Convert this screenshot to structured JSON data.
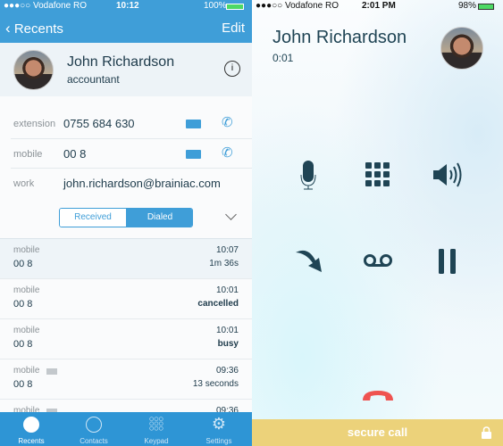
{
  "left": {
    "status": {
      "carrier": "●●●○○ Vodafone RO",
      "time": "10:12",
      "battery": "100%"
    },
    "nav": {
      "back_label": "Recents",
      "edit_label": "Edit"
    },
    "contact": {
      "first": "John",
      "last": "Richardson",
      "title": "accountant"
    },
    "fields": [
      {
        "label": "extension",
        "value": "0755 684 630"
      },
      {
        "label": "mobile",
        "value": "00 8"
      },
      {
        "label": "work",
        "value": "john.richardson@brainiac.com"
      }
    ],
    "segments": {
      "received": "Received",
      "dialed": "Dialed",
      "selected": "Dialed"
    },
    "calls": [
      {
        "type": "mobile",
        "number": "00 8",
        "time": "10:07",
        "status": "1m 36s",
        "video": false
      },
      {
        "type": "mobile",
        "number": "00 8",
        "time": "10:01",
        "status": "cancelled",
        "video": false
      },
      {
        "type": "mobile",
        "number": "00 8",
        "time": "10:01",
        "status": "busy",
        "video": false
      },
      {
        "type": "mobile",
        "number": "00 8",
        "time": "09:36",
        "status": "13 seconds",
        "video": true
      },
      {
        "type": "mobile",
        "number": "",
        "time": "09:36",
        "status": "",
        "video": true
      }
    ],
    "tabs": [
      {
        "label": "Recents",
        "icon": "clock-icon"
      },
      {
        "label": "Contacts",
        "icon": "person-icon"
      },
      {
        "label": "Keypad",
        "icon": "keypad-icon"
      },
      {
        "label": "Settings",
        "icon": "gear-icon"
      }
    ],
    "active_tab": "Recents"
  },
  "right": {
    "status": {
      "carrier": "●●●○○ Vodafone RO",
      "time": "2:01 PM",
      "battery": "98%"
    },
    "caller": "John Richardson",
    "duration": "0:01",
    "controls": [
      "microphone-icon",
      "keypad-icon",
      "speaker-icon",
      "transfer-icon",
      "voicemail-icon",
      "pause-icon"
    ],
    "secure_label": "secure call"
  },
  "colors": {
    "accent": "#3f9ed8",
    "tabbar": "#2e95d5",
    "icon_dark": "#1f4454",
    "hangup": "#ef5350",
    "secure": "#ecd27a"
  }
}
